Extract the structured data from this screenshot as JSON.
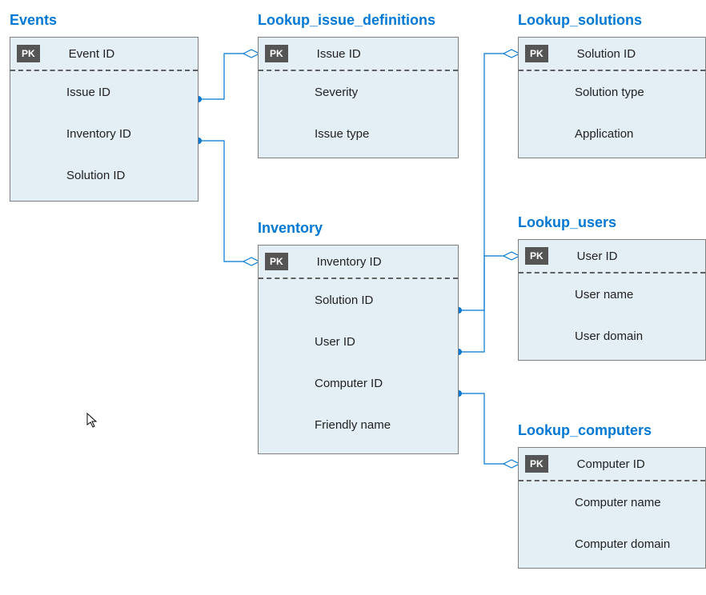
{
  "entities": {
    "events": {
      "title": "Events",
      "pk_label": "PK",
      "pk_field": "Event ID",
      "fields": [
        "Issue ID",
        "Inventory ID",
        "Solution ID"
      ]
    },
    "lookup_issue_definitions": {
      "title": "Lookup_issue_definitions",
      "pk_label": "PK",
      "pk_field": "Issue ID",
      "fields": [
        "Severity",
        "Issue type"
      ]
    },
    "lookup_solutions": {
      "title": "Lookup_solutions",
      "pk_label": "PK",
      "pk_field": "Solution ID",
      "fields": [
        "Solution type",
        "Application"
      ]
    },
    "inventory": {
      "title": "Inventory",
      "pk_label": "PK",
      "pk_field": "Inventory ID",
      "fields": [
        "Solution ID",
        "User ID",
        "Computer ID",
        "Friendly name"
      ]
    },
    "lookup_users": {
      "title": "Lookup_users",
      "pk_label": "PK",
      "pk_field": "User ID",
      "fields": [
        "User name",
        "User domain"
      ]
    },
    "lookup_computers": {
      "title": "Lookup_computers",
      "pk_label": "PK",
      "pk_field": "Computer ID",
      "fields": [
        "Computer name",
        "Computer domain"
      ]
    }
  },
  "colors": {
    "entity_bg": "#e4eef5",
    "title": "#0078d4",
    "connector": "#0078d4"
  }
}
